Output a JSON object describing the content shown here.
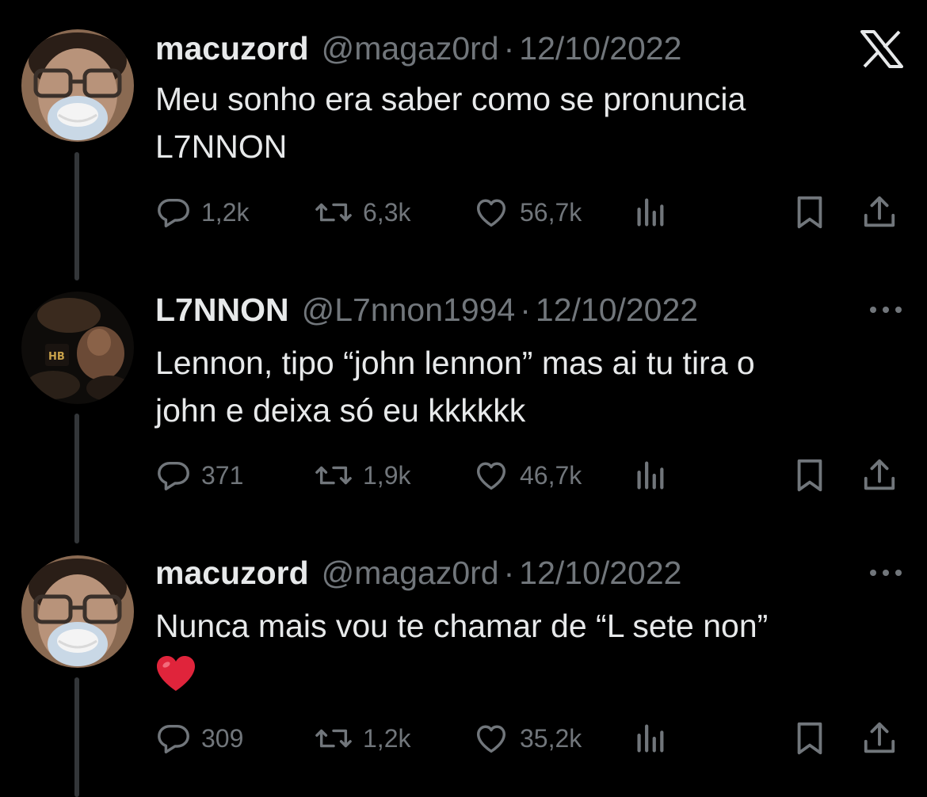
{
  "thread": {
    "x_logo": "X",
    "tweets": [
      {
        "display_name": "macuzord",
        "handle": "@magaz0rd",
        "separator": "·",
        "date": "12/10/2022",
        "text_lines": [
          "Meu sonho era saber como se pronuncia",
          "L7NNON"
        ],
        "replies": "1,2k",
        "retweets": "6,3k",
        "likes": "56,7k",
        "corner_icon": "x-logo-icon"
      },
      {
        "display_name": "L7NNON",
        "handle": "@L7nnon1994",
        "separator": "·",
        "date": "12/10/2022",
        "text_lines": [
          "Lennon, tipo “john lennon” mas ai tu tira o",
          "john e deixa só eu kkkkkk"
        ],
        "replies": "371",
        "retweets": "1,9k",
        "likes": "46,7k",
        "corner_icon": "more-options-icon"
      },
      {
        "display_name": "macuzord",
        "handle": "@magaz0rd",
        "separator": "·",
        "date": "12/10/2022",
        "text_lines": [
          "Nunca mais vou te chamar de “L sete  non”"
        ],
        "emoji": "red-heart-emoji",
        "replies": "309",
        "retweets": "1,2k",
        "likes": "35,2k",
        "corner_icon": "more-options-icon"
      }
    ]
  },
  "icons": {
    "reply": "reply-icon",
    "retweet": "retweet-icon",
    "like": "like-icon",
    "views": "views-icon",
    "bookmark": "bookmark-icon",
    "share": "share-icon"
  },
  "colors": {
    "background": "#000000",
    "primary_text": "#e7e9ea",
    "secondary_text": "#71767b",
    "thread_line": "#333639",
    "heart_emoji": "#e0243b"
  }
}
